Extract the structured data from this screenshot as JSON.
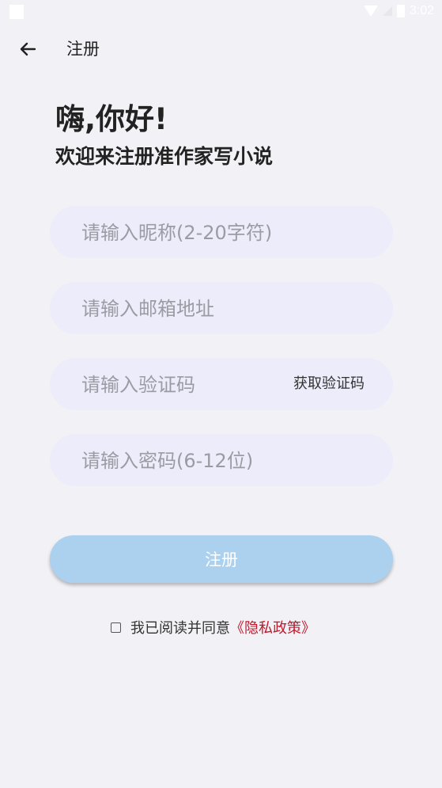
{
  "status_bar": {
    "time": "3:02"
  },
  "header": {
    "title": "注册",
    "back_icon": "arrow-left-icon"
  },
  "intro": {
    "greeting": "嗨,你好!",
    "subtitle": "欢迎来注册准作家写小说"
  },
  "form": {
    "nickname_placeholder": "请输入昵称(2-20字符)",
    "email_placeholder": "请输入邮箱地址",
    "code_placeholder": "请输入验证码",
    "get_code_label": "获取验证码",
    "password_placeholder": "请输入密码(6-12位)"
  },
  "submit": {
    "label": "注册"
  },
  "agreement": {
    "text": "我已阅读并同意",
    "policy_link": "《隐私政策》"
  },
  "colors": {
    "background": "#f2f2f6",
    "field_background": "#ececfb",
    "button_background": "#acd1ee",
    "link_color": "#c0182b"
  }
}
